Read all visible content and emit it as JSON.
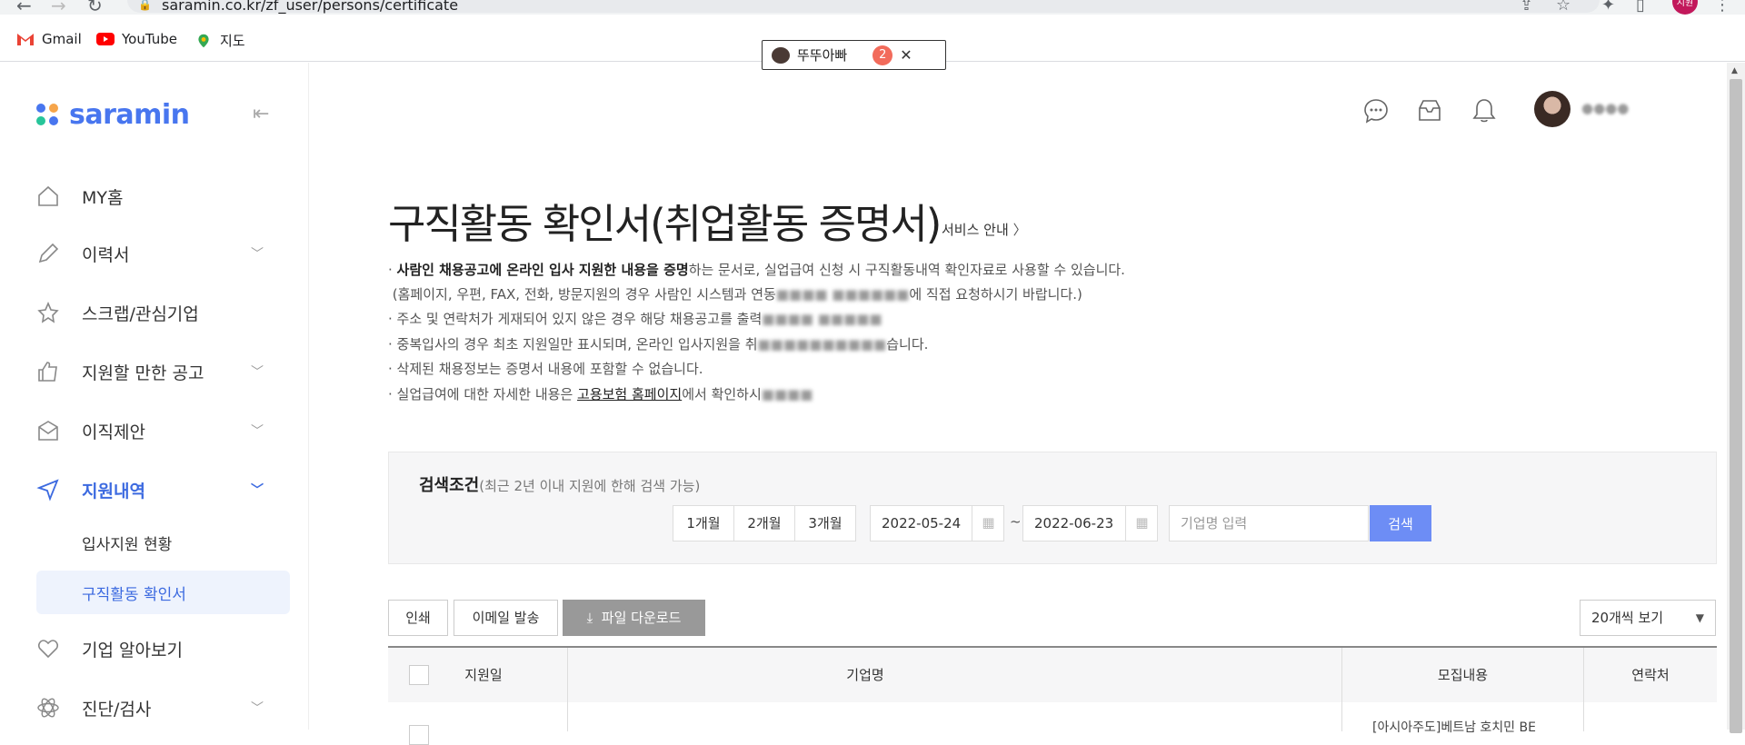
{
  "browser": {
    "url": "saramin.co.kr/zf_user/persons/certificate",
    "profile_label": "지원",
    "bookmarks": [
      "Gmail",
      "YouTube",
      "지도"
    ],
    "tab_popup": {
      "title": "뚜뚜아빠",
      "count": "2"
    }
  },
  "sidebar": {
    "logo": "saramin",
    "items": [
      {
        "label": "MY홈",
        "icon": "home-icon"
      },
      {
        "label": "이력서",
        "icon": "pencil-icon"
      },
      {
        "label": "스크랩/관심기업",
        "icon": "star-icon"
      },
      {
        "label": "지원할 만한 공고",
        "icon": "thumbs-up-icon"
      },
      {
        "label": "이직제안",
        "icon": "mail-icon"
      },
      {
        "label": "지원내역",
        "icon": "send-icon"
      },
      {
        "label": "기업 알아보기",
        "icon": "heart-icon"
      },
      {
        "label": "진단/검사",
        "icon": "atom-icon"
      }
    ],
    "sub_items": [
      "입사지원 현황",
      "구직활동 확인서"
    ]
  },
  "page": {
    "title": "구직활동 확인서(취업활동 증명서)",
    "service_link": "서비스 안내",
    "notices": {
      "n1_bold": "사람인 채용공고에 온라인 입사 지원한 내용을 증명",
      "n1_rest": "하는 문서로, 실업급여 신청 시 구직활동내역 확인자료로 사용할 수 있습니다.",
      "n2": "(홈페이지, 우편, FAX, 전화, 방문지원의 경우 사람인 시스템과 연동",
      "n2_tail": "에 직접 요청하시기 바랍니다.)",
      "n3": "주소 및 연락처가 게재되어 있지 않은 경우 해당 채용공고를 출력",
      "n4": "중복입사의 경우 최초 지원일만 표시되며, 온라인 입사지원을 취",
      "n4_tail": "습니다.",
      "n5": "삭제된 채용정보는 증명서 내용에 포함할 수 없습니다.",
      "n6_pre": "실업급여에 대한 자세한 내용은 ",
      "n6_link": "고용보험 홈페이지",
      "n6_post": "에서 확인하시"
    }
  },
  "search": {
    "title": "검색조건",
    "subtitle": "(최근 2년 이내 지원에 한해 검색 가능)",
    "periods": [
      "1개월",
      "2개월",
      "3개월"
    ],
    "date_from": "2022-05-24",
    "date_to": "2022-06-23",
    "separator": "~",
    "company_placeholder": "기업명 입력",
    "button": "검색"
  },
  "actions": {
    "print": "인쇄",
    "email": "이메일 발송",
    "download": "파일 다운로드",
    "page_size": "20개씩 보기"
  },
  "table": {
    "headers": [
      "지원일",
      "기업명",
      "모집내용",
      "연락처"
    ],
    "first_row_preview": "[아시아주도]베트남 호치민 BE"
  },
  "colors": {
    "accent": "#3c6ae0",
    "search_button": "#6d8df5"
  }
}
